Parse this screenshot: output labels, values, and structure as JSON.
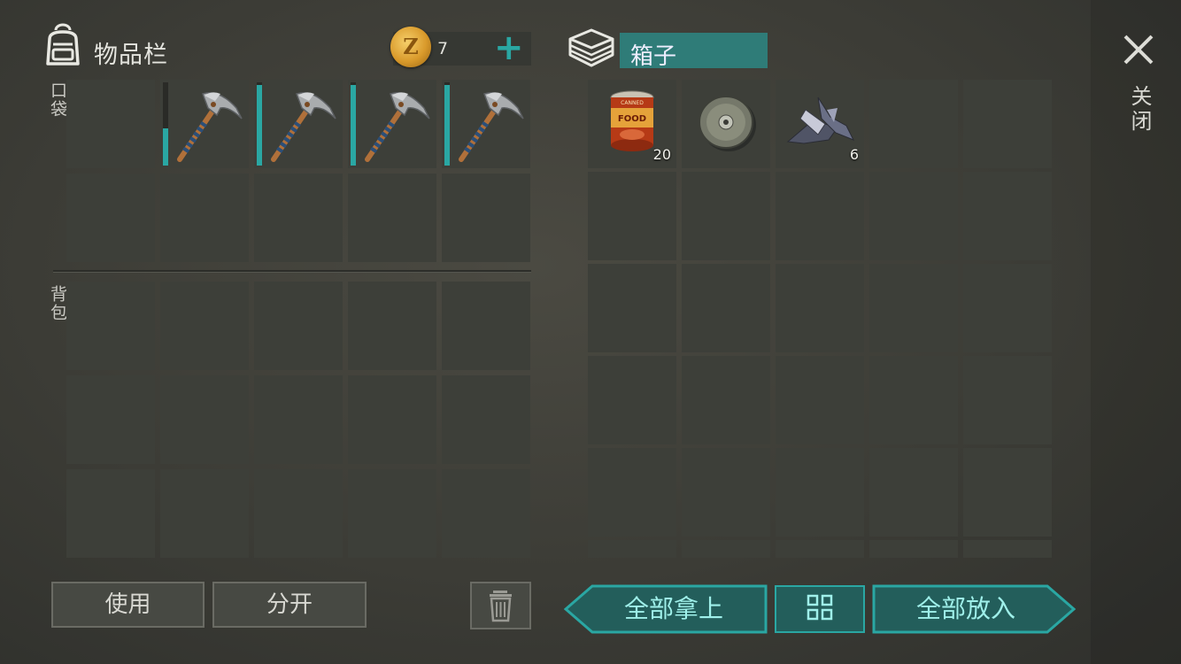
{
  "inventory": {
    "title": "物品栏",
    "coins": "7",
    "pocket_label": "口袋",
    "backpack_label": "背包",
    "pocket_slots": [
      {
        "item": "",
        "durability": 0
      },
      {
        "item": "pickaxe",
        "durability": 0.45
      },
      {
        "item": "pickaxe",
        "durability": 0.97
      },
      {
        "item": "pickaxe",
        "durability": 0.97
      },
      {
        "item": "pickaxe",
        "durability": 0.97
      }
    ]
  },
  "container": {
    "title": "箱子",
    "items": [
      {
        "item": "canned-food",
        "qty": "20"
      },
      {
        "item": "metal-disc",
        "qty": ""
      },
      {
        "item": "scrap-metal",
        "qty": "6"
      }
    ],
    "canned_label": "FOOD",
    "canned_top": "CANNED"
  },
  "close_label": "关闭",
  "buttons": {
    "use": "使用",
    "split": "分开",
    "take_all": "全部拿上",
    "put_all": "全部放入"
  },
  "colors": {
    "accent": "#2aa7a3",
    "slot": "#3d3f39",
    "title_box": "#2f7c78"
  }
}
